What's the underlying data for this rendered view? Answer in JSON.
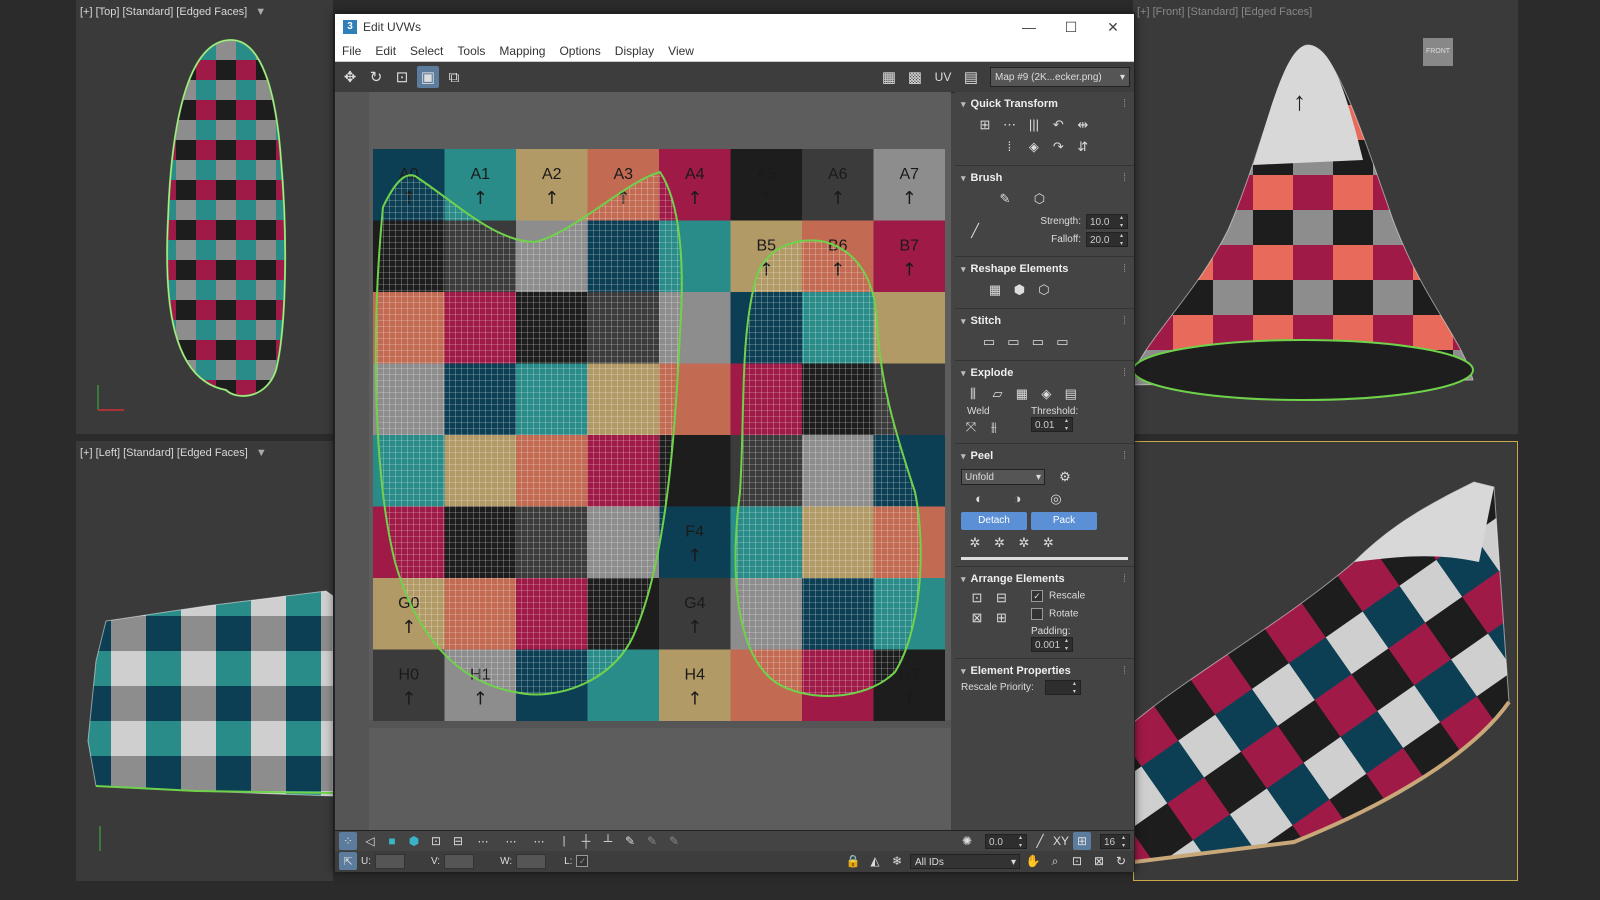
{
  "viewports": {
    "top": {
      "label": "[+] [Top] [Standard] [Edged Faces]"
    },
    "left": {
      "label": "[+] [Left] [Standard] [Edged Faces]"
    },
    "front": {
      "label": "[+] [Front] [Standard] [Edged Faces]"
    },
    "viewcube": {
      "label": "FRONT"
    }
  },
  "window": {
    "title": "Edit UVWs",
    "menu": [
      "File",
      "Edit",
      "Select",
      "Tools",
      "Mapping",
      "Options",
      "Display",
      "View"
    ],
    "map_select": "Map #9 (2K...ecker.png)",
    "uv_label": "UV"
  },
  "checker": {
    "rows": [
      "A",
      "B",
      "C",
      "D",
      "E",
      "F",
      "G",
      "H"
    ],
    "colors": [
      [
        "#0d3f54",
        "#2a8c88",
        "#b29a66",
        "#c26a52",
        "#a01a48",
        "#1d1d1d",
        "#3b3b3b",
        "#8d8d8d"
      ],
      [
        "#1d1d1d",
        "#3b3b3b",
        "#8d8d8d",
        "#0d3f54",
        "#2a8c88",
        "#b29a66",
        "#c26a52",
        "#a01a48"
      ],
      [
        "#c26a52",
        "#a01a48",
        "#1d1d1d",
        "#3b3b3b",
        "#8d8d8d",
        "#0d3f54",
        "#2a8c88",
        "#b29a66"
      ],
      [
        "#8d8d8d",
        "#0d3f54",
        "#2a8c88",
        "#b29a66",
        "#c26a52",
        "#a01a48",
        "#1d1d1d",
        "#3b3b3b"
      ],
      [
        "#2a8c88",
        "#b29a66",
        "#c26a52",
        "#a01a48",
        "#1d1d1d",
        "#3b3b3b",
        "#8d8d8d",
        "#0d3f54"
      ],
      [
        "#a01a48",
        "#1d1d1d",
        "#3b3b3b",
        "#8d8d8d",
        "#0d3f54",
        "#2a8c88",
        "#b29a66",
        "#c26a52"
      ],
      [
        "#b29a66",
        "#c26a52",
        "#a01a48",
        "#1d1d1d",
        "#3b3b3b",
        "#8d8d8d",
        "#0d3f54",
        "#2a8c88"
      ],
      [
        "#3b3b3b",
        "#8d8d8d",
        "#0d3f54",
        "#2a8c88",
        "#b29a66",
        "#c26a52",
        "#a01a48",
        "#1d1d1d"
      ]
    ],
    "visible_labels": [
      "A0",
      "A1",
      "A2",
      "A3",
      "A4",
      "A5",
      "A6",
      "A7",
      "B5",
      "B6",
      "B7",
      "F4",
      "G0",
      "G4",
      "H0",
      "H1",
      "H4",
      "H7"
    ]
  },
  "panel": {
    "quick_transform": {
      "title": "Quick Transform"
    },
    "brush": {
      "title": "Brush",
      "strength_label": "Strength:",
      "strength_value": "10.0",
      "falloff_label": "Falloff:",
      "falloff_value": "20.0"
    },
    "reshape": {
      "title": "Reshape Elements"
    },
    "stitch": {
      "title": "Stitch"
    },
    "explode": {
      "title": "Explode",
      "weld_label": "Weld",
      "threshold_label": "Threshold:",
      "threshold_value": "0.01"
    },
    "peel": {
      "title": "Peel",
      "unfold_value": "Unfold",
      "detach_label": "Detach",
      "pack_label": "Pack"
    },
    "arrange": {
      "title": "Arrange Elements",
      "rescale_label": "Rescale",
      "rotate_label": "Rotate",
      "padding_label": "Padding:",
      "padding_value": "0.001",
      "rescale_checked": true,
      "rotate_checked": false
    },
    "element_props": {
      "title": "Element Properties",
      "rescale_priority_label": "Rescale Priority:"
    }
  },
  "statusbar": {
    "angle_value": "0.0",
    "xy_label": "XY",
    "grid_value": "16",
    "u_label": "U:",
    "v_label": "V:",
    "w_label": "W:",
    "l_label": "L:",
    "ids_value": "All IDs"
  },
  "colors": {
    "accent_blue": "#5b8fd6",
    "selection_green": "#6fd24a"
  }
}
